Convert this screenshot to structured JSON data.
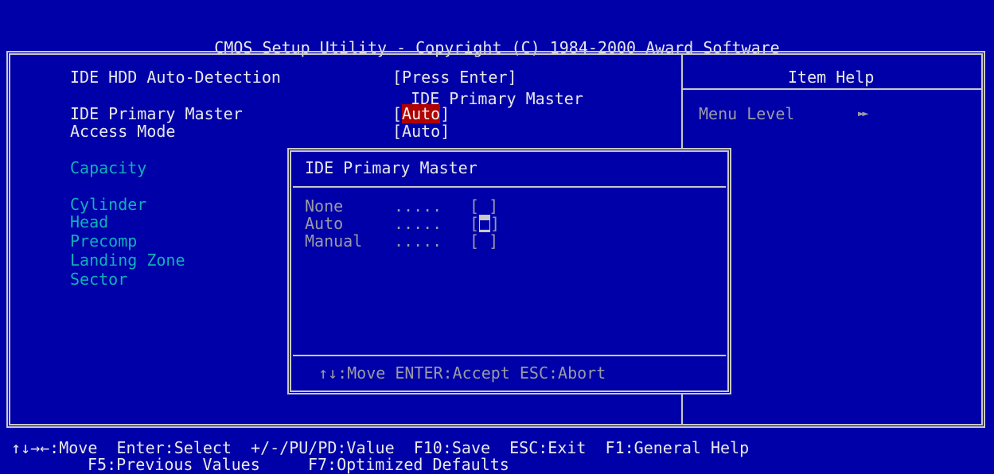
{
  "header": {
    "line1": "CMOS Setup Utility - Copyright (C) 1984-2000 Award Software",
    "line2": "IDE Primary Master"
  },
  "settings": {
    "autodetect_label": "IDE HDD Auto-Detection",
    "autodetect_value": "[Press Enter]",
    "primary_master_label": "IDE Primary Master",
    "primary_master_value": "Auto",
    "access_mode_label": "Access Mode",
    "access_mode_value": "Auto",
    "capacity_label": "Capacity",
    "cylinder_label": "Cylinder",
    "head_label": "Head",
    "precomp_label": "Precomp",
    "landing_zone_label": "Landing Zone",
    "sector_label": "Sector"
  },
  "help": {
    "title": "Item Help",
    "menu_level_label": "Menu Level",
    "menu_level_arrows": "►►"
  },
  "popup": {
    "title": "IDE Primary Master",
    "options": [
      {
        "label": "None",
        "dots": ".....",
        "selected": false
      },
      {
        "label": "Auto",
        "dots": ".....",
        "selected": true
      },
      {
        "label": "Manual",
        "dots": ".....",
        "selected": false
      }
    ],
    "hint": "↑↓:Move ENTER:Accept ESC:Abort"
  },
  "footer": {
    "line1": "↑↓→←:Move  Enter:Select  +/-/PU/PD:Value  F10:Save  ESC:Exit  F1:General Help",
    "line2": "F5:Previous Values     F7:Optimized Defaults"
  },
  "colors": {
    "background": "#0000a8",
    "text": "#e8e8e8",
    "disabled_text": "#10b0b8",
    "highlight": "#b00000"
  }
}
